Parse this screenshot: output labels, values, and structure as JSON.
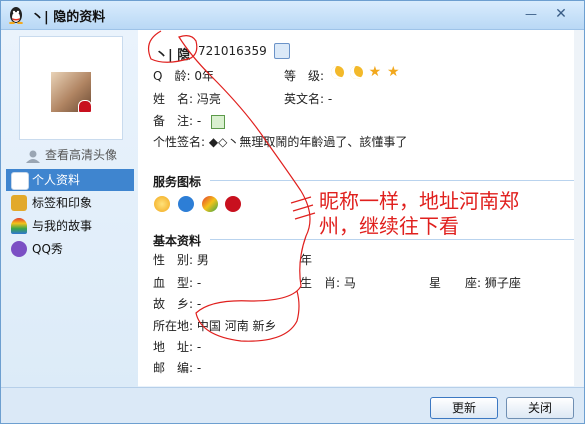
{
  "window": {
    "title": "丶| 隐的资料",
    "minimize_glyph": "—",
    "close_glyph": "✕"
  },
  "sidebar": {
    "hd_avatar_link": "查看高清头像",
    "items": [
      {
        "label": "个人资料",
        "icon": "profile-card-icon",
        "active": true
      },
      {
        "label": "标签和印象",
        "icon": "tag-icon",
        "active": false
      },
      {
        "label": "与我的故事",
        "icon": "rainbow-icon",
        "active": false
      },
      {
        "label": "QQ秀",
        "icon": "qqshow-icon",
        "active": false
      }
    ]
  },
  "profile": {
    "nickname": "丶| 隐",
    "qq_number": "721016359",
    "age_label": "Q　龄:",
    "age_value": "0年",
    "level_label": "等　级:",
    "name_label": "姓　名:",
    "name_value": "冯亮",
    "english_name_label": "英文名:",
    "english_name_value": "-",
    "remark_label": "备　注:",
    "remark_value": "-",
    "signature_label": "个性签名:",
    "signature_value": "◆◇丶無理取鬧的年齡過了、該懂事了"
  },
  "services": {
    "title": "服务图标"
  },
  "basic": {
    "title": "基本资料",
    "gender_label": "性　别:",
    "gender_value": "男",
    "year_label": "年",
    "blood_label": "血　型:",
    "blood_value": "-",
    "zodiac_label": "生　肖:",
    "zodiac_value": "马",
    "constellation_label": "星　　座:",
    "constellation_value": "狮子座",
    "hometown_label": "故　乡:",
    "hometown_value": "-",
    "location_label": "所在地:",
    "location_value": "中国 河南 新乡",
    "address_label": "地　址:",
    "address_value": "-",
    "zip_label": "邮　编:",
    "zip_value": "-"
  },
  "buttons": {
    "refresh": "更新",
    "close": "关闭"
  },
  "annotation": {
    "line1": "昵称一样，地址河南郑",
    "line2": "州，继续往下看",
    "color": "#e0201e"
  }
}
